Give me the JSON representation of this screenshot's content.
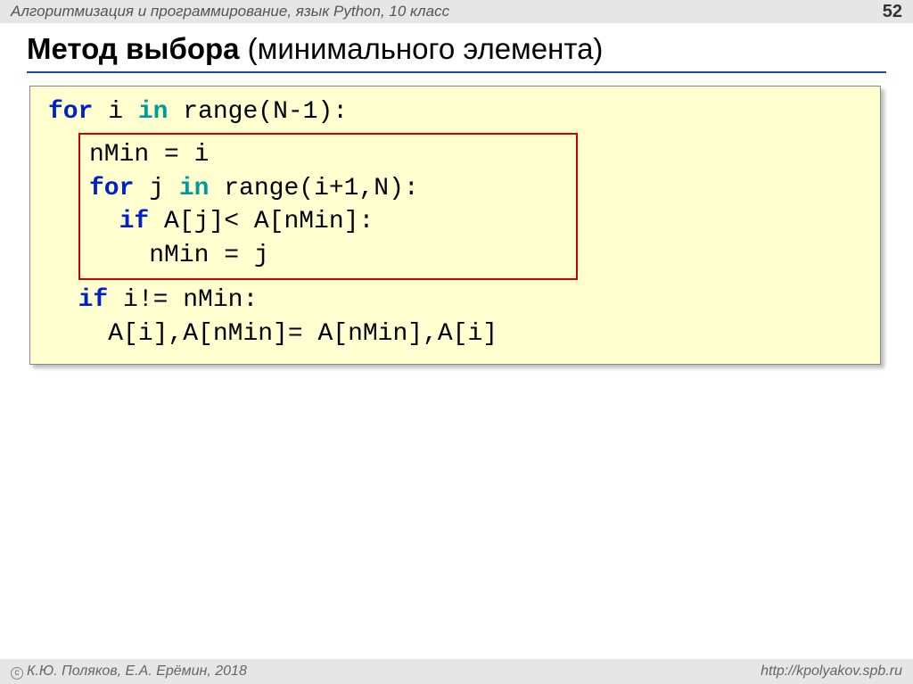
{
  "header": {
    "subject": "Алгоритмизация и программирование, язык Python, 10 класс",
    "page": "52"
  },
  "title": {
    "bold": "Метод выбора",
    "rest": " (минимального элемента)"
  },
  "code": {
    "line1_for": "for",
    "line1_mid": " i ",
    "line1_in": "in",
    "line1_rest": " range(N-1):",
    "inner_line1": "nMin = i",
    "inner_line2_for": "for",
    "inner_line2_mid": " j ",
    "inner_line2_in": "in",
    "inner_line2_rest": " range(i+1,N):",
    "inner_line3_if": "if",
    "inner_line3_rest": " A[j]< A[nMin]:",
    "inner_line4": "nMin = j",
    "line_after1_if": "if",
    "line_after1_rest": " i!= nMin:",
    "line_after2": "A[i],A[nMin]= A[nMin],A[i]"
  },
  "footer": {
    "authors": "К.Ю. Поляков, Е.А. Ерёмин, 2018",
    "url": "http://kpolyakov.spb.ru"
  }
}
